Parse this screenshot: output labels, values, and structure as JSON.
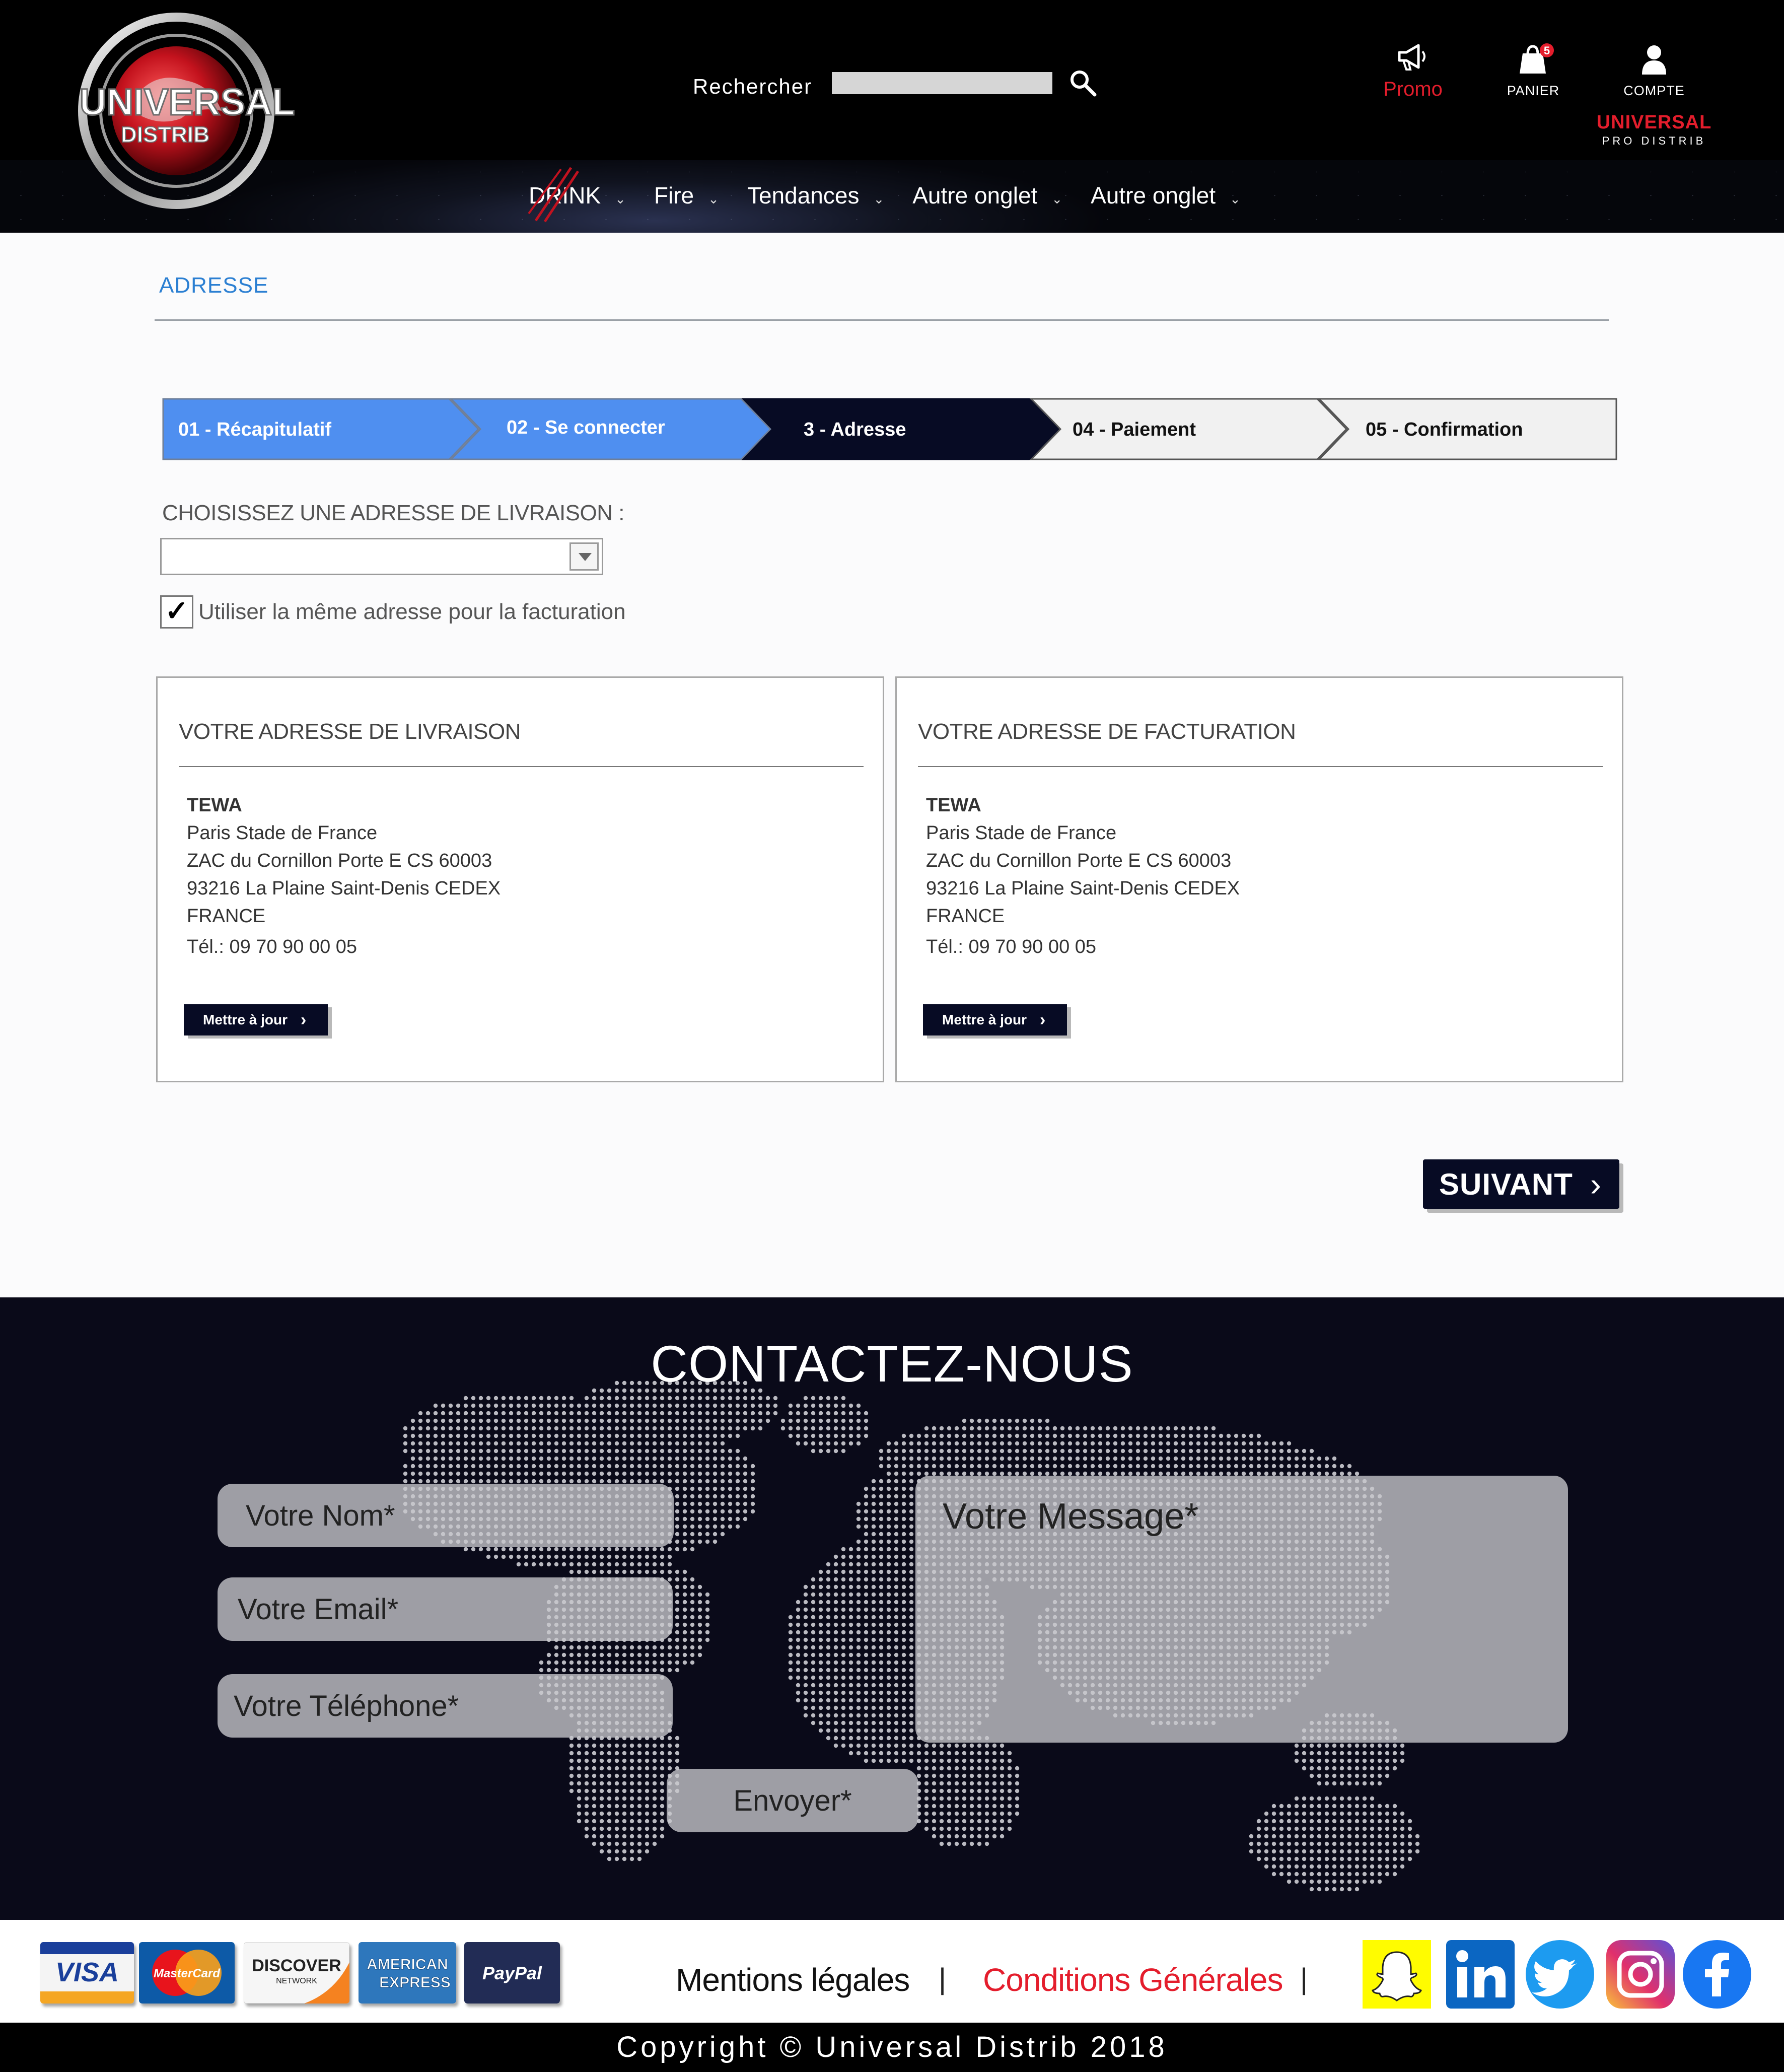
{
  "header": {
    "logo": {
      "word1": "UNIVERSAL",
      "word2": "DISTRIB"
    },
    "search_label": "Rechercher",
    "search_value": "",
    "promo_label": "Promo",
    "cart_label": "PANIER",
    "cart_count": "5",
    "account_label": "COMPTE",
    "pro_logo": {
      "line1": "UNIVERSAL",
      "line2": "PRO DISTRIB"
    },
    "nav": [
      {
        "label": "DRINK"
      },
      {
        "label": "Fire"
      },
      {
        "label": "Tendances"
      },
      {
        "label": "Autre onglet"
      },
      {
        "label": "Autre onglet"
      }
    ]
  },
  "page": {
    "title": "ADRESSE",
    "steps": [
      {
        "label": "01 - Récapitulatif",
        "state": "done"
      },
      {
        "label": "02 - Se connecter",
        "state": "done"
      },
      {
        "label": "3 - Adresse",
        "state": "current"
      },
      {
        "label": "04 - Paiement",
        "state": "todo"
      },
      {
        "label": "05 - Confirmation",
        "state": "todo"
      }
    ],
    "choose_label": "CHOISISSEZ UNE ADRESSE DE LIVRAISON :",
    "selected_address": "",
    "same_address_label": "Utiliser la même adresse pour la facturation",
    "same_address_checked": true,
    "shipping": {
      "title": "VOTRE ADRESSE DE LIVRAISON",
      "name": "TEWA",
      "lines": [
        "Paris Stade de France",
        "ZAC du Cornillon Porte E CS 60003",
        "93216 La Plaine Saint-Denis CEDEX",
        "FRANCE"
      ],
      "tel": "Tél.: 09 70 90 00 05",
      "button": "Mettre à jour"
    },
    "billing": {
      "title": "VOTRE ADRESSE DE FACTURATION",
      "name": "TEWA",
      "lines": [
        "Paris Stade de France",
        "ZAC du Cornillon Porte E CS 60003",
        "93216 La Plaine Saint-Denis CEDEX",
        "FRANCE"
      ],
      "tel": "Tél.: 09 70 90 00 05",
      "button": "Mettre à jour"
    },
    "next_button": "SUIVANT"
  },
  "contact": {
    "title": "CONTACTEZ-NOUS",
    "name_placeholder": "Votre Nom*",
    "email_placeholder": "Votre Email*",
    "phone_placeholder": "Votre Téléphone*",
    "message_placeholder": "Votre Message*",
    "send_label": "Envoyer*"
  },
  "footer": {
    "cards": [
      {
        "name": "VISA",
        "icon": "visa-icon"
      },
      {
        "name": "MasterCard",
        "icon": "mastercard-icon"
      },
      {
        "name": "DISCOVER",
        "sub": "NETWORK",
        "icon": "discover-icon"
      },
      {
        "name": "AMERICAN",
        "sub": "EXPRESS",
        "icon": "amex-icon"
      },
      {
        "name": "PayPal",
        "icon": "paypal-icon"
      }
    ],
    "legal_link": "Mentions légales",
    "terms_link": "Conditions Générales",
    "separator": "|",
    "social": [
      "snapchat-icon",
      "linkedin-icon",
      "twitter-icon",
      "instagram-icon",
      "facebook-icon"
    ],
    "copyright": "Copyright © Universal Distrib 2018"
  },
  "colors": {
    "accent_blue": "#2b7fd2",
    "step_done": "#4f8ff0",
    "step_current": "#070b24",
    "brand_red": "#e41d2c",
    "terms_red": "#e41d2c"
  }
}
